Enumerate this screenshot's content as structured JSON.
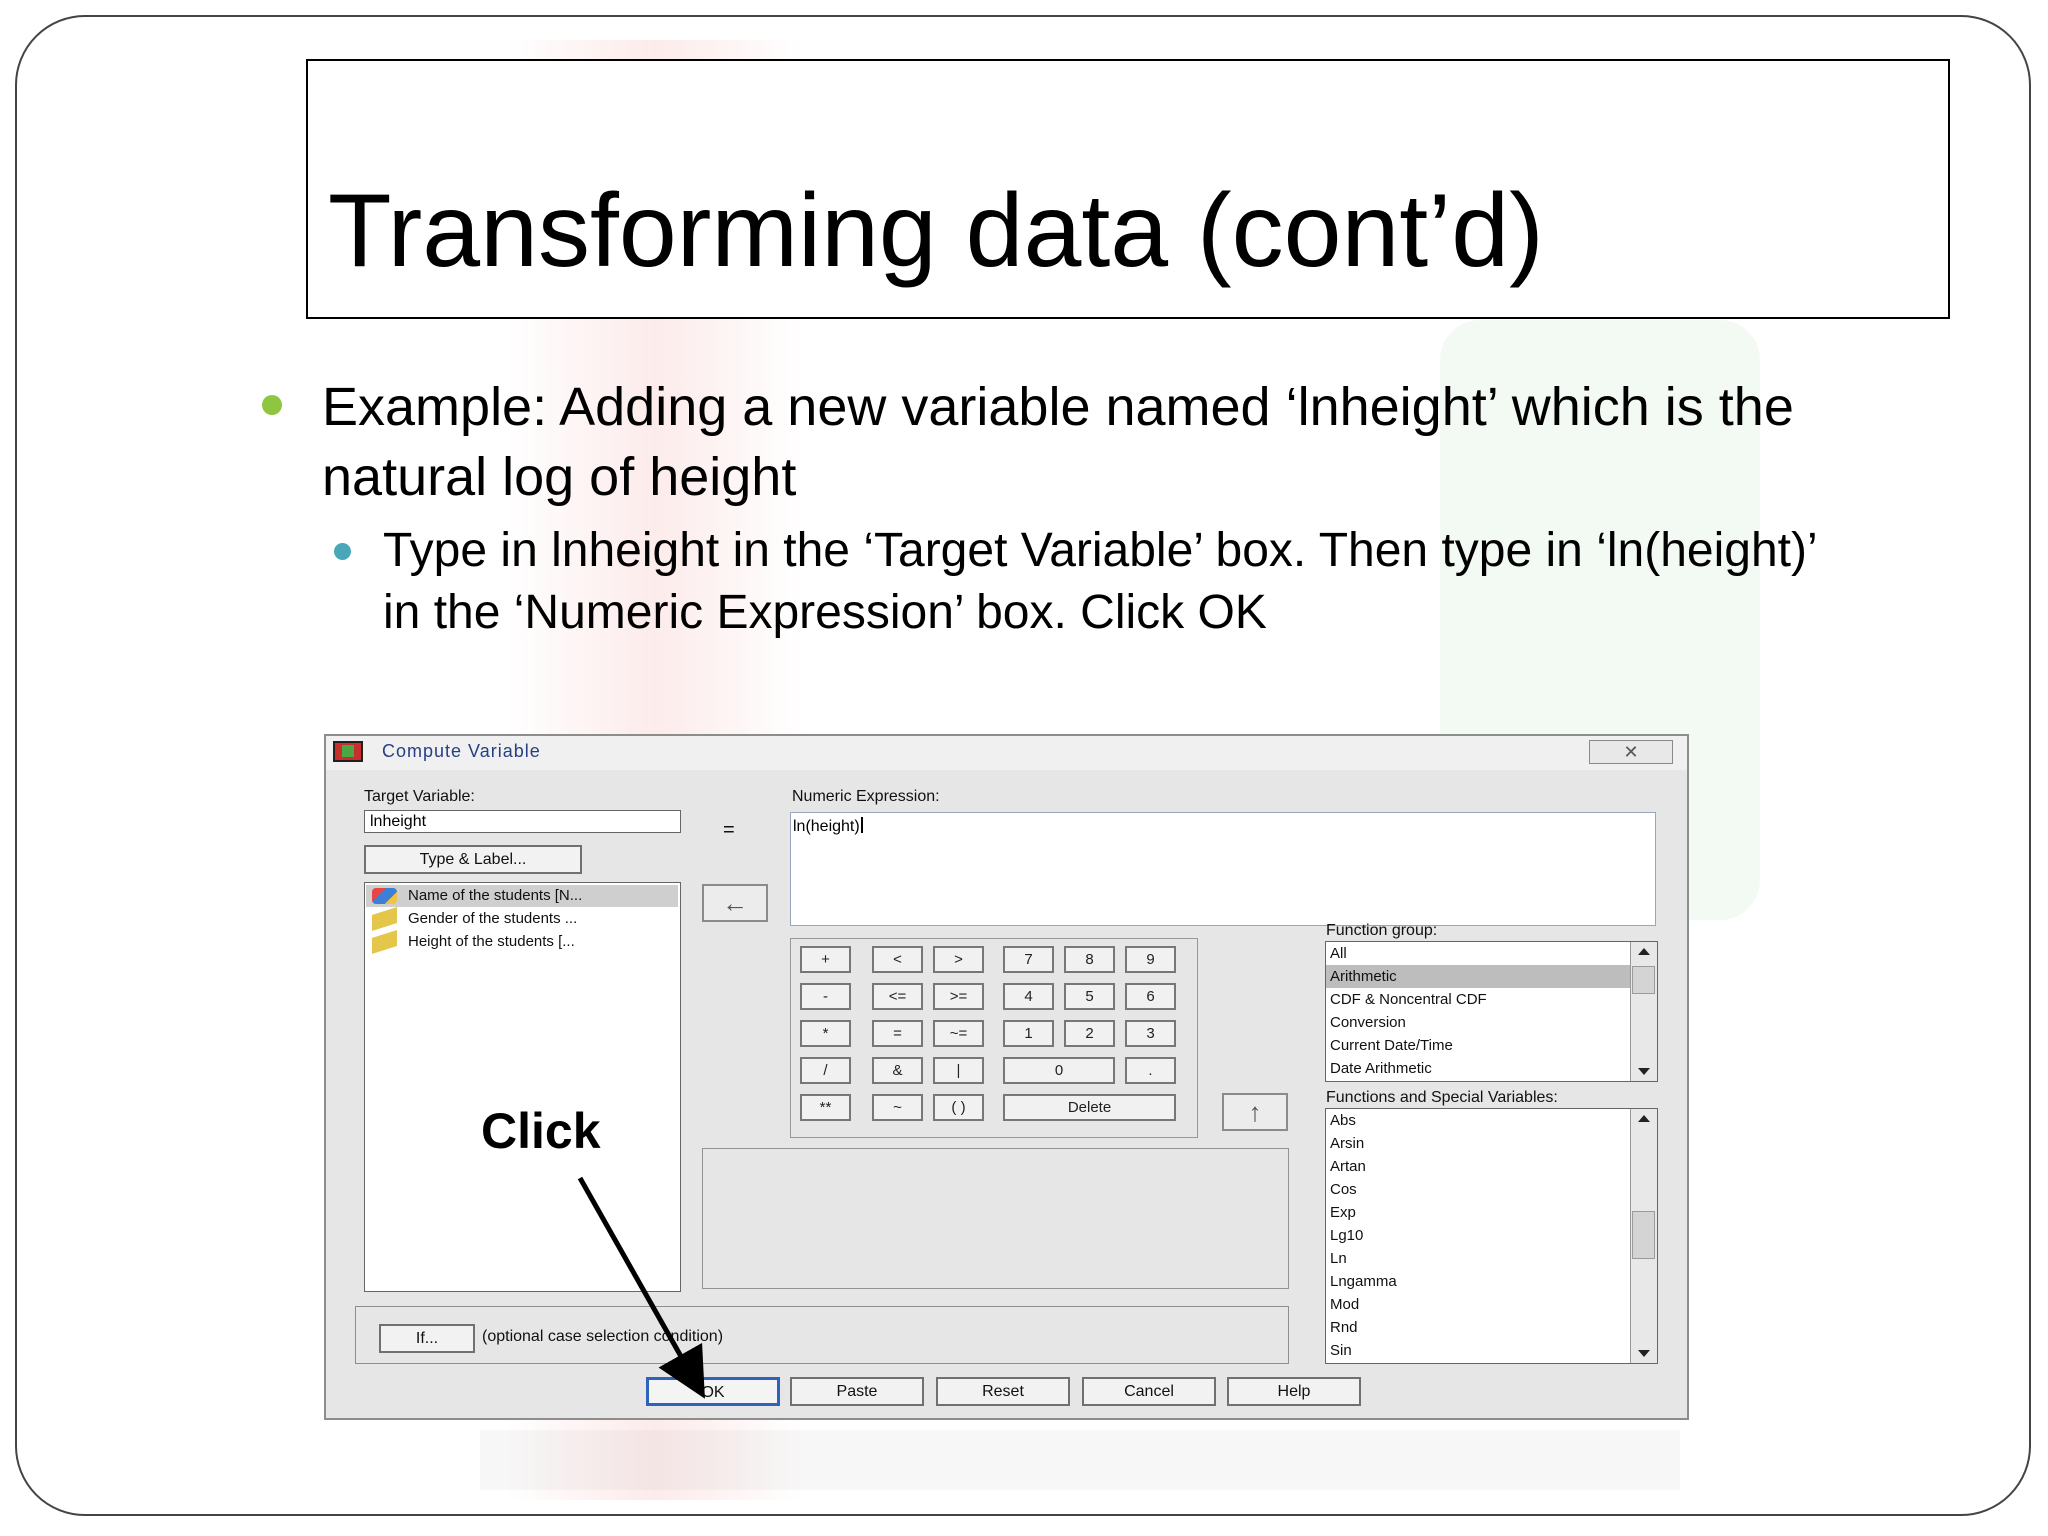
{
  "slide": {
    "title": "Transforming data (cont’d)",
    "bullet_1": "Example: Adding a new variable named ‘lnheight’ which is the natural log of height",
    "bullet_2": "Type in lnheight in the ‘Target Variable’ box. Then type in ‘ln(height)’ in the ‘Numeric Expression’ box. Click OK",
    "annotation": "Click"
  },
  "dialog": {
    "title": "Compute Variable",
    "close_label": "✕",
    "target_label": "Target Variable:",
    "target_value": "lnheight",
    "equals": "=",
    "numeric_label": "Numeric Expression:",
    "numeric_value": "ln(height)",
    "type_label_button": "Type & Label...",
    "variables": [
      "Name of the students [N...",
      "Gender of the students ...",
      "Height of the students [..."
    ],
    "keypad": {
      "plus": "+",
      "lt": "<",
      "gt": ">",
      "seven": "7",
      "eight": "8",
      "nine": "9",
      "minus": "-",
      "le": "<=",
      "ge": ">=",
      "four": "4",
      "five": "5",
      "six": "6",
      "multiply": "*",
      "eq": "=",
      "ne": "~=",
      "one": "1",
      "two": "2",
      "three": "3",
      "divide": "/",
      "and": "&",
      "or": "|",
      "zero": "0",
      "dot": ".",
      "power": "**",
      "not": "~",
      "parens": "( )",
      "delete": "Delete"
    },
    "function_group_label": "Function group:",
    "function_groups": [
      "All",
      "Arithmetic",
      "CDF & Noncentral CDF",
      "Conversion",
      "Current Date/Time",
      "Date Arithmetic"
    ],
    "functions_label": "Functions and Special Variables:",
    "functions": [
      "Abs",
      "Arsin",
      "Artan",
      "Cos",
      "Exp",
      "Lg10",
      "Ln",
      "Lngamma",
      "Mod",
      "Rnd",
      "Sin"
    ],
    "if_button": "If...",
    "if_text": "(optional case selection condition)",
    "buttons": {
      "ok": "OK",
      "paste": "Paste",
      "reset": "Reset",
      "cancel": "Cancel",
      "help": "Help"
    }
  }
}
